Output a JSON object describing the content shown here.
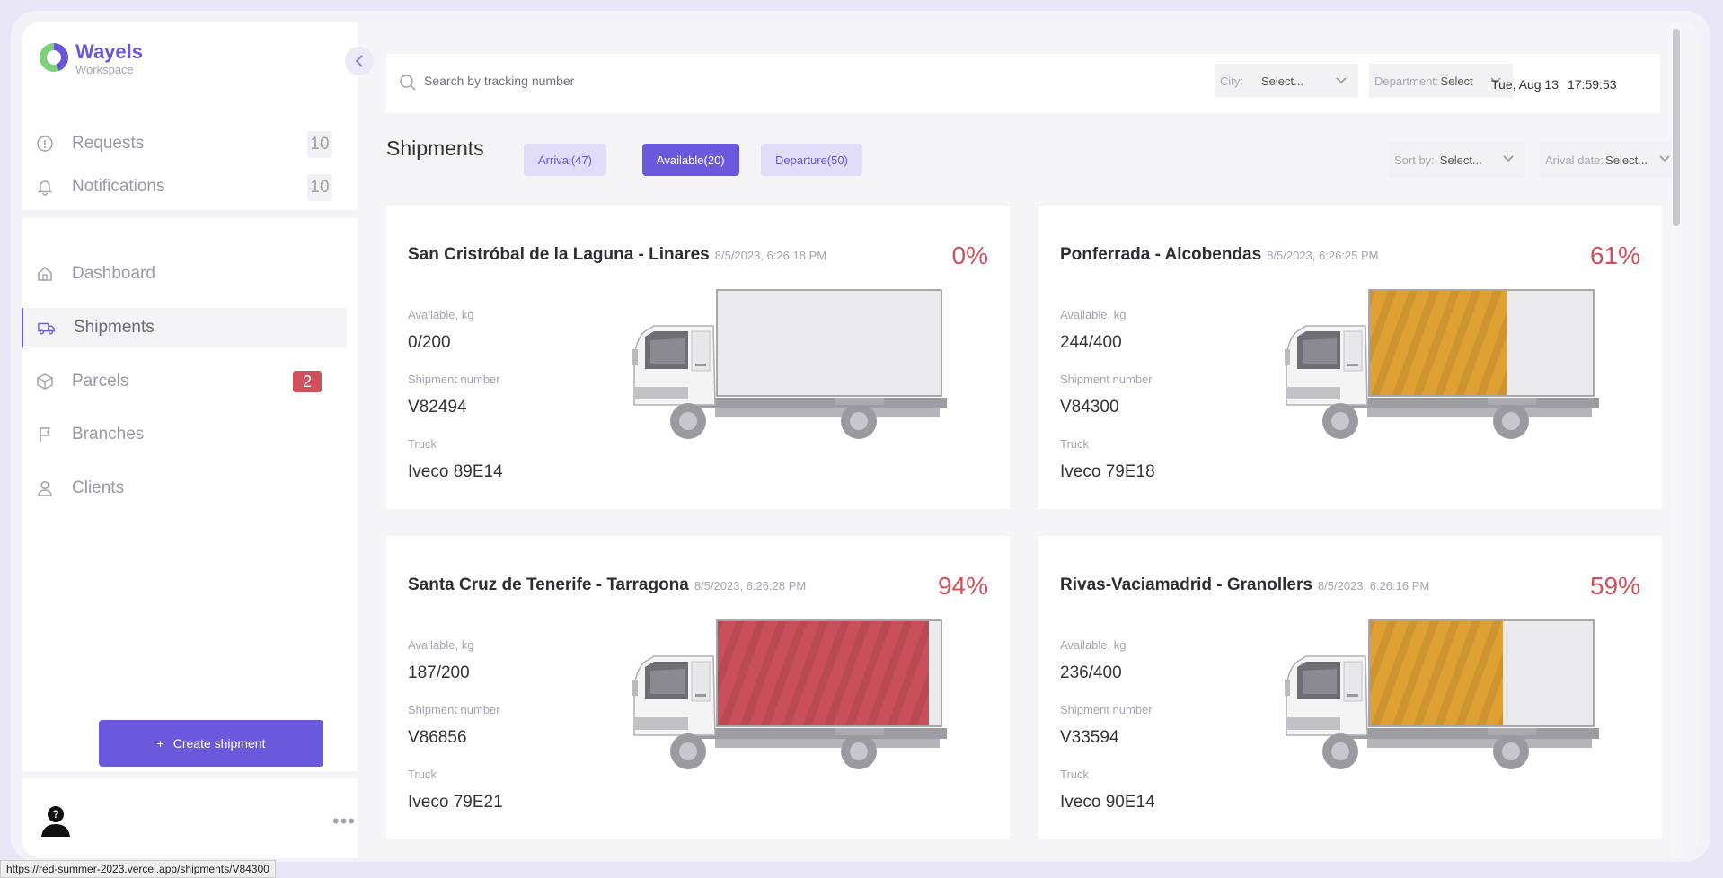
{
  "brand": {
    "name": "Wayels",
    "subtitle": "Workspace"
  },
  "sidebar": {
    "top_items": [
      {
        "label": "Requests",
        "count": "10"
      },
      {
        "label": "Notifications",
        "count": "10"
      }
    ],
    "nav": [
      {
        "label": "Dashboard"
      },
      {
        "label": "Shipments"
      },
      {
        "label": "Parcels",
        "badge": "2"
      },
      {
        "label": "Branches"
      },
      {
        "label": "Clients"
      }
    ],
    "create_label": "Create shipment",
    "create_plus": "+",
    "more": "•••"
  },
  "search": {
    "placeholder": "Search by tracking number"
  },
  "filters": {
    "city_label": "City:",
    "city_value": "Select...",
    "dept_label": "Department:",
    "dept_value": "Select",
    "sort_label": "Sort by:",
    "sort_value": "Select...",
    "arrival_label": "Arival date:",
    "arrival_value": "Select..."
  },
  "datetime": {
    "date": "Tue, Aug 13",
    "time": "17:59:53"
  },
  "page": {
    "title": "Shipments"
  },
  "tabs": [
    {
      "label": "Arrival(47)"
    },
    {
      "label": "Available(20)"
    },
    {
      "label": "Departure(50)"
    }
  ],
  "field_labels": {
    "available": "Available, kg",
    "number": "Shipment number",
    "truck": "Truck"
  },
  "shipments": [
    {
      "route": "San Cristróbal de la Laguna - Linares",
      "date": "8/5/2023, 6:26:18 PM",
      "percent": "0%",
      "fill": 0,
      "available": "0/200",
      "number": "V82494",
      "truck": "Iveco 89E14",
      "color": "#d9d9de"
    },
    {
      "route": "Ponferrada - Alcobendas",
      "date": "8/5/2023, 6:26:25 PM",
      "percent": "61%",
      "fill": 0.61,
      "available": "244/400",
      "number": "V84300",
      "truck": "Iveco 79E18",
      "color": "#e0a134"
    },
    {
      "route": "Santa Cruz de Tenerife - Tarragona",
      "date": "8/5/2023, 6:26:28 PM",
      "percent": "94%",
      "fill": 0.94,
      "available": "187/200",
      "number": "V86856",
      "truck": "Iveco 79E21",
      "color": "#c9505b"
    },
    {
      "route": "Rivas-Vaciamadrid - Granollers",
      "date": "8/5/2023, 6:26:16 PM",
      "percent": "59%",
      "fill": 0.59,
      "available": "236/400",
      "number": "V33594",
      "truck": "Iveco 90E14",
      "color": "#e0a134"
    }
  ],
  "status_url": "https://red-summer-2023.vercel.app/shipments/V84300"
}
